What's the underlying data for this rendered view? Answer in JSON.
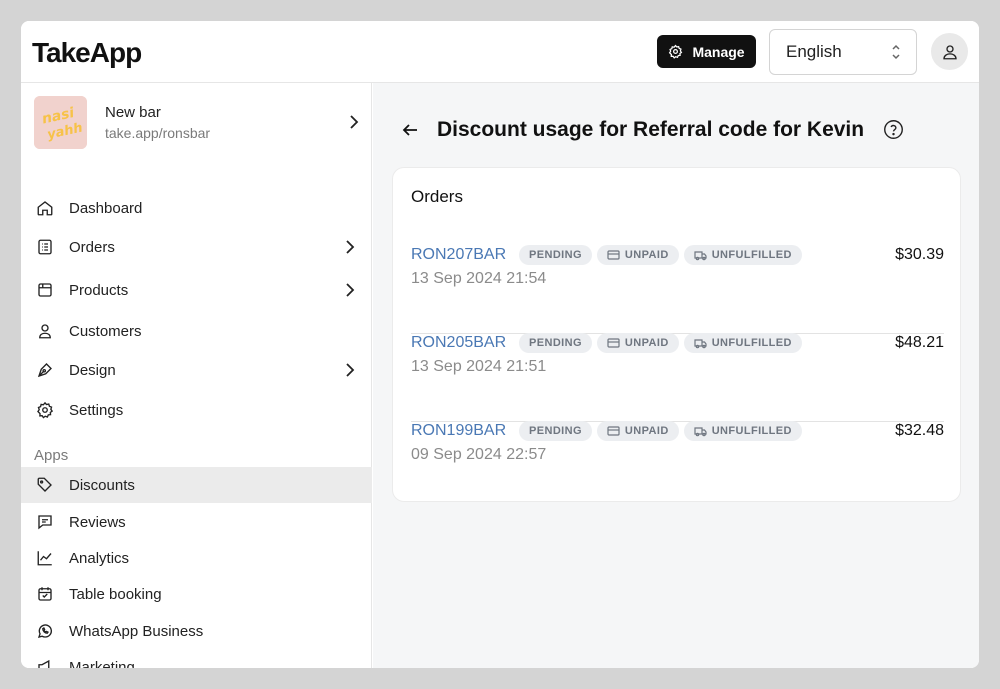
{
  "header": {
    "logo": "TakeApp",
    "manage_label": "Manage",
    "language": "English"
  },
  "store": {
    "name": "New bar",
    "url": "take.app/ronsbar",
    "logo_text": "nasi"
  },
  "sidebar": {
    "items": [
      {
        "label": "Dashboard",
        "icon": "home-icon"
      },
      {
        "label": "Orders",
        "icon": "receipt-icon"
      },
      {
        "label": "Products",
        "icon": "box-icon"
      },
      {
        "label": "Customers",
        "icon": "user-icon"
      },
      {
        "label": "Design",
        "icon": "pen-icon"
      },
      {
        "label": "Settings",
        "icon": "gear-icon"
      }
    ],
    "apps_label": "Apps",
    "apps": [
      {
        "label": "Discounts",
        "icon": "tag-icon",
        "active": true
      },
      {
        "label": "Reviews",
        "icon": "chat-icon"
      },
      {
        "label": "Analytics",
        "icon": "chart-icon"
      },
      {
        "label": "Table booking",
        "icon": "calendar-icon"
      },
      {
        "label": "WhatsApp Business",
        "icon": "whatsapp-icon"
      },
      {
        "label": "Marketing",
        "icon": "megaphone-icon"
      }
    ]
  },
  "main": {
    "title": "Discount usage for Referral code for Kevin",
    "card_title": "Orders",
    "orders": [
      {
        "id": "RON207BAR",
        "date": "13 Sep 2024 21:54",
        "total": "$30.39",
        "badges": [
          "PENDING",
          "UNPAID",
          "UNFULFILLED"
        ]
      },
      {
        "id": "RON205BAR",
        "date": "13 Sep 2024 21:51",
        "total": "$48.21",
        "badges": [
          "PENDING",
          "UNPAID",
          "UNFULFILLED"
        ]
      },
      {
        "id": "RON199BAR",
        "date": "09 Sep 2024 22:57",
        "total": "$32.48",
        "badges": [
          "PENDING",
          "UNPAID",
          "UNFULFILLED"
        ]
      }
    ]
  },
  "colors": {
    "link": "#4a78b4",
    "badge_bg": "#eceef1",
    "active_nav_bg": "#ebebeb"
  }
}
